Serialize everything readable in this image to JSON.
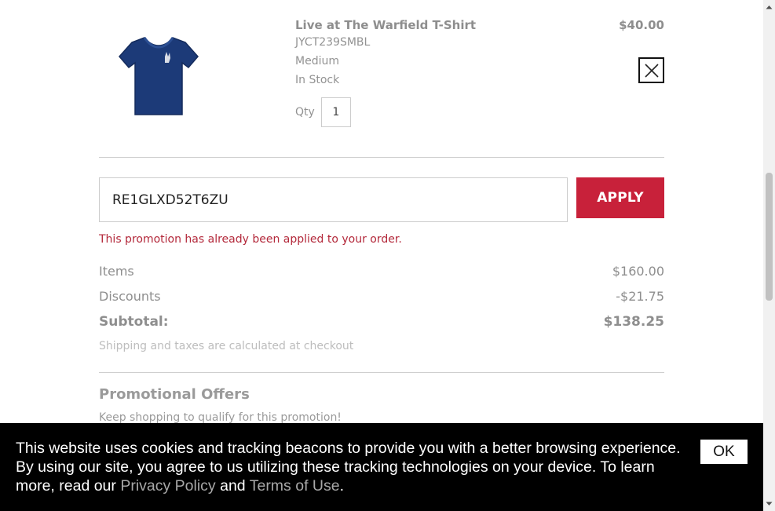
{
  "cart_item": {
    "name": "Live at The Warfield T-Shirt",
    "sku": "JYCT239SMBL",
    "size": "Medium",
    "stock_status": "In Stock",
    "qty_label": "Qty",
    "qty_value": "1",
    "price": "$40.00",
    "image_icon": "navy-t-shirt-icon",
    "shirt_color": "#1c3a78"
  },
  "promo": {
    "code_value": "RE1GLXD52T6ZU",
    "apply_label": "APPLY",
    "error_message": "This promotion has already been applied to your order."
  },
  "totals": {
    "items_label": "Items",
    "items_value": "$160.00",
    "discounts_label": "Discounts",
    "discounts_value": "-$21.75",
    "subtotal_label": "Subtotal:",
    "subtotal_value": "$138.25",
    "shipping_note": "Shipping and taxes are calculated at checkout"
  },
  "promotional_offers": {
    "heading": "Promotional Offers",
    "description": "Keep shopping to qualify for this promotion!"
  },
  "cookie_banner": {
    "text_before": "This website uses cookies and tracking beacons to provide you with a better browsing experience. By using our site, you agree to us utilizing these tracking technologies on your device. To learn more, read our ",
    "privacy_link": "Privacy Policy",
    "and_text": " and ",
    "terms_link": "Terms of Use",
    "period": ".",
    "ok_label": "OK"
  },
  "colors": {
    "accent": "#c8213a",
    "error": "#b3283a",
    "banner_bg": "#000000"
  }
}
